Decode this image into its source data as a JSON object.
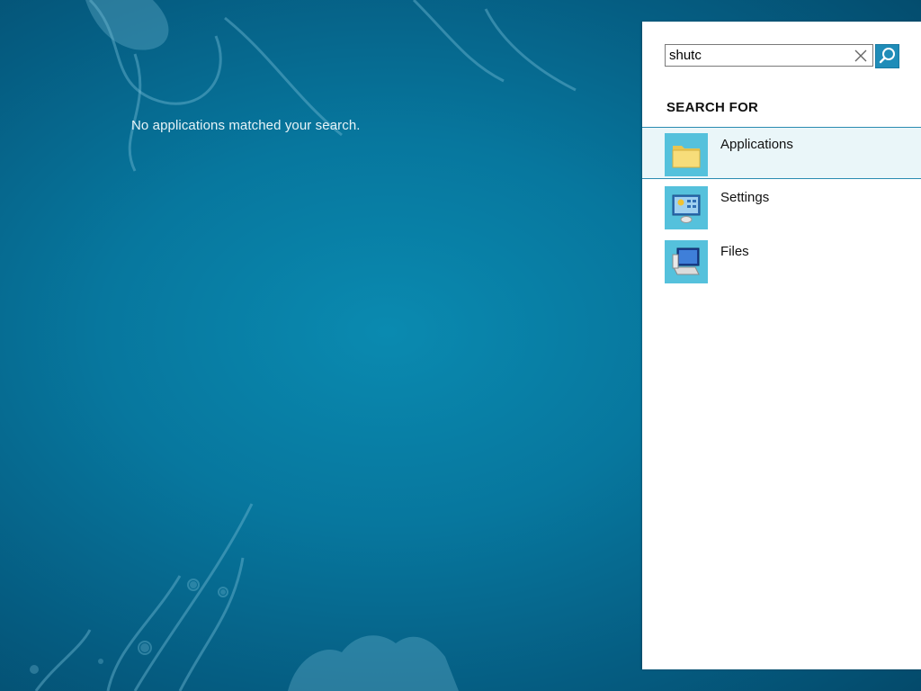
{
  "desktop": {
    "message": "No applications matched your search."
  },
  "search": {
    "value": "shutc",
    "placeholder": "",
    "clear_icon": "close-icon",
    "search_icon": "search-icon"
  },
  "panel": {
    "heading": "SEARCH FOR",
    "categories": [
      {
        "label": "Applications",
        "icon": "folder-icon",
        "selected": true
      },
      {
        "label": "Settings",
        "icon": "control-panel-icon",
        "selected": false
      },
      {
        "label": "Files",
        "icon": "computer-files-icon",
        "selected": false
      }
    ]
  },
  "colors": {
    "accent": "#1f8cb8",
    "tile": "#55c1dc",
    "selection_bg": "#eaf6f9",
    "selection_border": "#2a8bb1"
  }
}
